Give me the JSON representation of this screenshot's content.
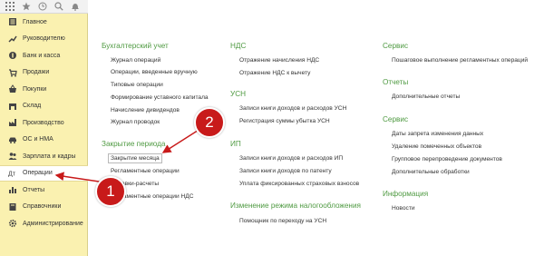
{
  "sidebar": {
    "items": [
      {
        "label": "Главное",
        "icon": "home-icon"
      },
      {
        "label": "Руководителю",
        "icon": "chart-trend-icon"
      },
      {
        "label": "Банк и касса",
        "icon": "coins-icon"
      },
      {
        "label": "Продажи",
        "icon": "cart-icon"
      },
      {
        "label": "Покупки",
        "icon": "basket-icon"
      },
      {
        "label": "Склад",
        "icon": "warehouse-icon"
      },
      {
        "label": "Производство",
        "icon": "factory-icon"
      },
      {
        "label": "ОС и НМА",
        "icon": "car-icon"
      },
      {
        "label": "Зарплата и кадры",
        "icon": "people-icon"
      },
      {
        "label": "Операции",
        "icon": "operations-icon",
        "active": true
      },
      {
        "label": "Отчеты",
        "icon": "bar-chart-icon"
      },
      {
        "label": "Справочники",
        "icon": "book-icon"
      },
      {
        "label": "Администрирование",
        "icon": "gear-icon"
      }
    ]
  },
  "col1": {
    "accounting": {
      "title": "Бухгалтерский учет",
      "items": [
        "Журнал операций",
        "Операции, введенные вручную",
        "Типовые операции",
        "Формирование уставного капитала",
        "Начисление дивидендов",
        "Журнал проводок"
      ]
    },
    "period_close": {
      "title": "Закрытие периода",
      "items": [
        "Закрытие месяца",
        "Регламентные операции",
        "Справки-расчеты",
        "Регламентные операции НДС"
      ]
    }
  },
  "col2": {
    "vat": {
      "title": "НДС",
      "items": [
        "Отражение начисления НДС",
        "Отражение НДС к вычету"
      ]
    },
    "usn": {
      "title": "УСН",
      "items": [
        "Записи книги доходов и расходов УСН",
        "Регистрация суммы убытка УСН"
      ]
    },
    "ip": {
      "title": "ИП",
      "items": [
        "Записи книги доходов и расходов ИП",
        "Записи книги доходов по патенту",
        "Уплата фиксированных страховых взносов"
      ]
    },
    "tax_change": {
      "title": "Изменение режима налогообложения",
      "items": [
        "Помощник по переходу на УСН"
      ]
    }
  },
  "col3": {
    "service1": {
      "title": "Сервис",
      "items": [
        "Пошаговое выполнение регламентных операций"
      ]
    },
    "reports": {
      "title": "Отчеты",
      "items": [
        "Дополнительные отчеты"
      ]
    },
    "service2": {
      "title": "Сервис",
      "items": [
        "Даты запрета изменения данных",
        "Удаление помеченных объектов",
        "Групповое перепроведение документов",
        "Дополнительные обработки"
      ]
    },
    "info": {
      "title": "Информация",
      "items": [
        "Новости"
      ]
    }
  },
  "callouts": {
    "one": "1",
    "two": "2"
  },
  "colors": {
    "sidebar_bg": "#faf1b0",
    "group_title": "#4f9a42",
    "callout": "#c81a1a"
  }
}
